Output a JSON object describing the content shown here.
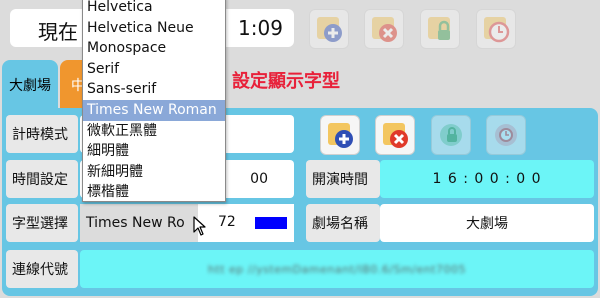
{
  "clock": {
    "label_visible": "現在",
    "time_fragment": "1:09"
  },
  "toolbar_top": [
    {
      "name": "add-button",
      "icon": "plus-circle-icon",
      "disabled": true
    },
    {
      "name": "delete-button",
      "icon": "x-circle-icon",
      "disabled": true
    },
    {
      "name": "lock-button",
      "icon": "lock-icon",
      "disabled": true
    },
    {
      "name": "timer-button",
      "icon": "clock-icon",
      "disabled": true
    }
  ],
  "tabs": [
    {
      "label": "大劇場",
      "active": true
    },
    {
      "label": "中",
      "active": false
    }
  ],
  "heading": "設定顯示字型",
  "rows": {
    "timer_mode": {
      "label": "計時模式"
    },
    "time_setting": {
      "label": "時間設定",
      "value": "00"
    },
    "font_select": {
      "label": "字型選擇",
      "selected": "Times New Ro",
      "size": "72",
      "color": "#0000ff"
    },
    "connection_code": {
      "label": "連線代號",
      "value": "htt ep //ystemDamenant/IB0.6/Sm/ent7005"
    }
  },
  "show_time": {
    "label": "開演時間",
    "value": "1 6 : 0 0 : 0 0"
  },
  "theatre_name": {
    "label": "劇場名稱",
    "value": "大劇場"
  },
  "panel_buttons": [
    {
      "name": "add-button",
      "icon": "plus-circle-icon",
      "disabled": false
    },
    {
      "name": "delete-button",
      "icon": "x-circle-icon",
      "disabled": false
    },
    {
      "name": "lock-button",
      "icon": "lock-icon",
      "disabled": true
    },
    {
      "name": "timer-button",
      "icon": "clock-icon",
      "disabled": true
    }
  ],
  "font_dropdown": {
    "options": [
      "Helvetica",
      "Helvetica Neue",
      "Monospace",
      "Serif",
      "Sans-serif",
      "Times New Roman",
      "微軟正黑體",
      "細明體",
      "新細明體",
      "標楷體"
    ],
    "highlighted": "Times New Roman"
  },
  "colors": {
    "panel": "#67c6e4",
    "field_cyan": "#6cf5f7",
    "heading": "#e8213a",
    "tab_inactive": "#f0962e",
    "dropdown_highlight": "#8aa8d8"
  }
}
